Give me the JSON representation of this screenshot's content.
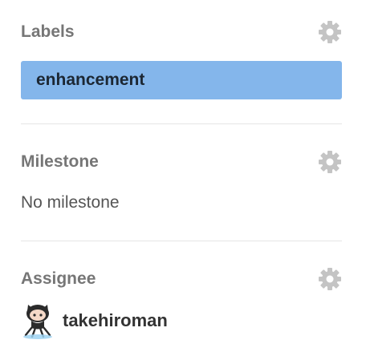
{
  "sidebar": {
    "labels": {
      "title": "Labels",
      "settings_icon": "gear-icon",
      "items": [
        {
          "name": "enhancement",
          "color": "#84b6eb"
        }
      ]
    },
    "milestone": {
      "title": "Milestone",
      "settings_icon": "gear-icon",
      "value": "No milestone"
    },
    "assignee": {
      "title": "Assignee",
      "settings_icon": "gear-icon",
      "user": {
        "name": "takehiroman",
        "avatar_icon": "octocat-avatar-icon"
      }
    }
  },
  "colors": {
    "heading": "#767676",
    "divider": "#e5e5e5",
    "gear": "#c4c4c4",
    "label_bg": "#84b6eb",
    "label_text": "#1c2733"
  }
}
